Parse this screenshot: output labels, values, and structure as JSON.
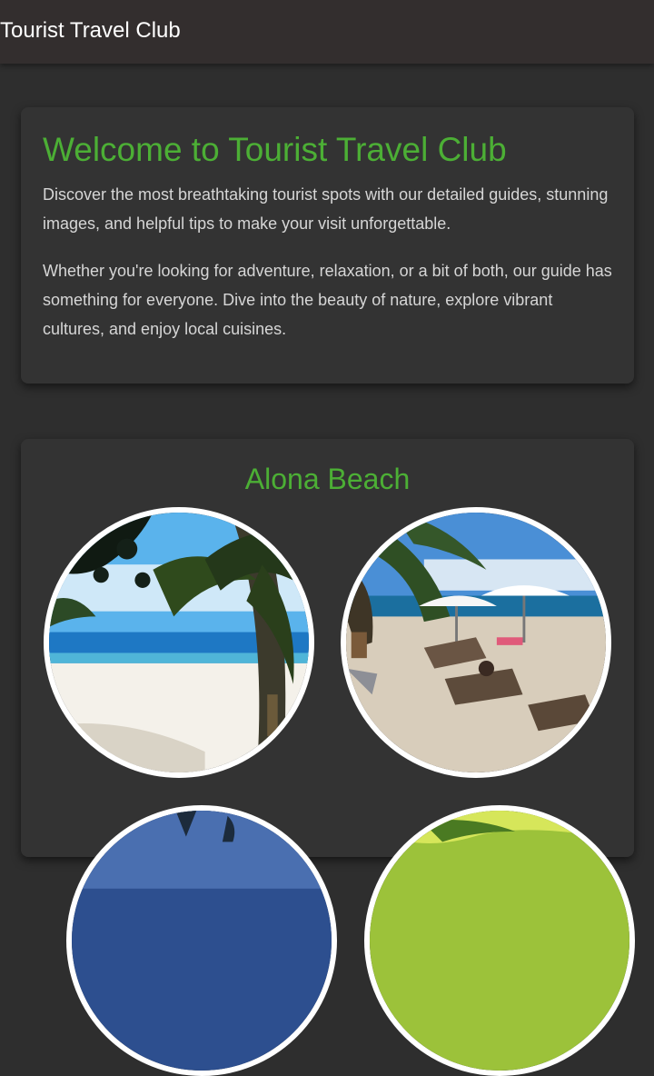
{
  "header": {
    "title": "Tourist Travel Club"
  },
  "intro": {
    "heading": "Welcome to Tourist Travel Club",
    "paragraph1": "Discover the most breathtaking tourist spots with our detailed guides, stunning images, and helpful tips to make your visit unforgettable.",
    "paragraph2": "Whether you're looking for adventure, relaxation, or a bit of both, our guide has something for everyone. Dive into the beauty of nature, explore vibrant cultures, and enjoy local cuisines."
  },
  "spot": {
    "title": "Alona Beach",
    "photo_count_visible": 4
  },
  "colors": {
    "accent": "#4caf35",
    "background": "#2e2e2e",
    "card": "#333333",
    "header": "#332e2e",
    "text": "#d6d6d6"
  }
}
